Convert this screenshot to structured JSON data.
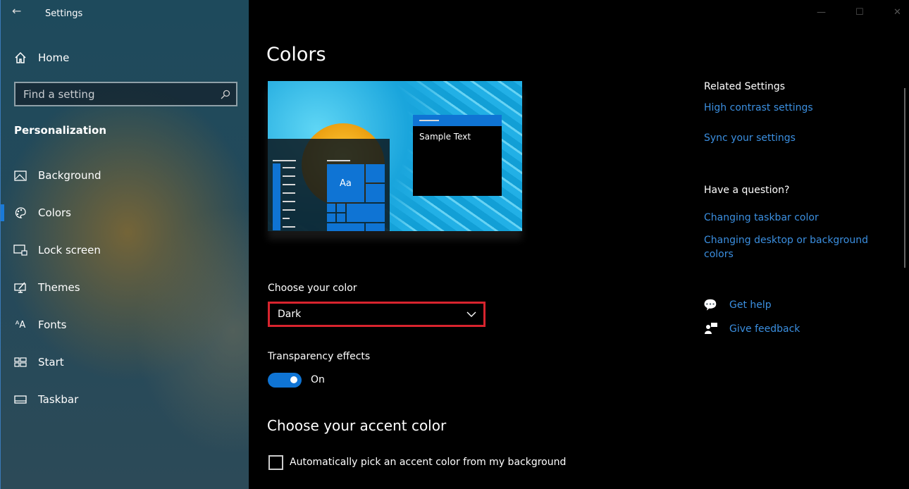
{
  "window": {
    "title": "Settings",
    "controls": [
      "minimize",
      "maximize",
      "close"
    ]
  },
  "sidebar": {
    "home": "Home",
    "search_placeholder": "Find a setting",
    "section": "Personalization",
    "items": [
      {
        "label": "Background",
        "icon": "picture-icon"
      },
      {
        "label": "Colors",
        "icon": "palette-icon",
        "selected": true
      },
      {
        "label": "Lock screen",
        "icon": "lock-screen-icon"
      },
      {
        "label": "Themes",
        "icon": "themes-icon"
      },
      {
        "label": "Fonts",
        "icon": "fonts-icon"
      },
      {
        "label": "Start",
        "icon": "start-icon"
      },
      {
        "label": "Taskbar",
        "icon": "taskbar-icon"
      }
    ]
  },
  "main": {
    "title": "Colors",
    "preview": {
      "sample_text": "Sample Text",
      "tile_text": "Aa"
    },
    "choose_color": {
      "label": "Choose your color",
      "value": "Dark"
    },
    "transparency": {
      "label": "Transparency effects",
      "state": "On",
      "on": true
    },
    "accent": {
      "heading": "Choose your accent color",
      "auto_pick": "Automatically pick an accent color from my background",
      "auto_checked": false
    }
  },
  "related": {
    "heading": "Related Settings",
    "links": [
      "High contrast settings",
      "Sync your settings"
    ],
    "question_heading": "Have a question?",
    "question_links": [
      "Changing taskbar color",
      "Changing desktop or background colors"
    ],
    "get_help": "Get help",
    "feedback": "Give feedback"
  },
  "colors": {
    "accent": "#0f74d4",
    "link": "#3b8fe0",
    "highlight_border": "#d8242e"
  }
}
